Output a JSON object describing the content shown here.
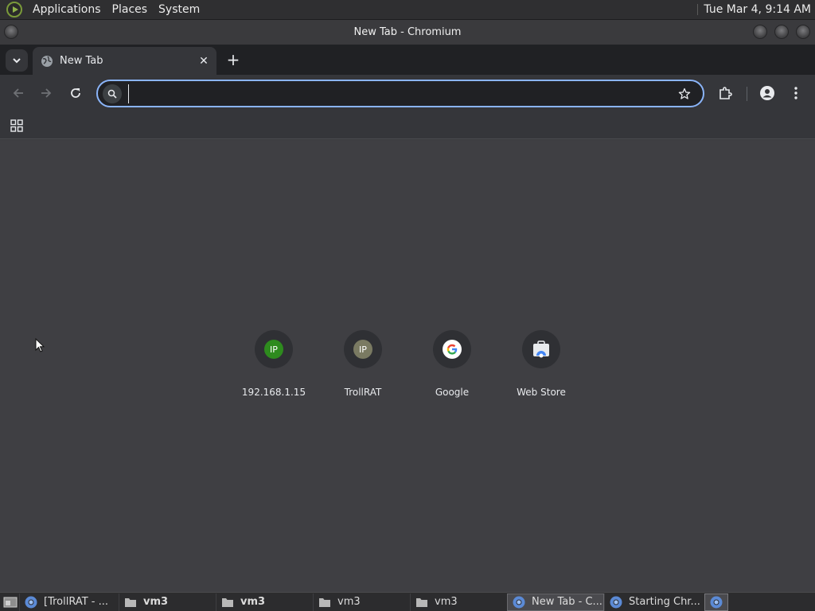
{
  "system_panel": {
    "menus": [
      "Applications",
      "Places",
      "System"
    ],
    "clock": "Tue Mar  4,  9:14 AM"
  },
  "window": {
    "title": "New Tab - Chromium"
  },
  "tabs": [
    {
      "title": "New Tab",
      "icon": "globe-icon",
      "close": "✕"
    }
  ],
  "toolbar": {
    "new_tab_glyph": "+",
    "omnibox_value": "",
    "omnibox_placeholder": ""
  },
  "shortcuts": [
    {
      "label": "192.168.1.15",
      "icon_text": "IP",
      "icon_color": "#2e8b1e"
    },
    {
      "label": "TrollRAT",
      "icon_text": "IP",
      "icon_color": "#7a7a62"
    },
    {
      "label": "Google",
      "icon": "google-icon"
    },
    {
      "label": "Web Store",
      "icon": "web-store-icon"
    }
  ],
  "taskbar": {
    "tasks": [
      {
        "label": "[TrollRAT - ...",
        "icon": "chromium-icon",
        "bold": false
      },
      {
        "label": "vm3",
        "icon": "folder-icon",
        "bold": true
      },
      {
        "label": "vm3",
        "icon": "folder-icon",
        "bold": true
      },
      {
        "label": "vm3",
        "icon": "folder-icon",
        "bold": false
      },
      {
        "label": "vm3",
        "icon": "folder-icon",
        "bold": false
      },
      {
        "label": "New Tab - C...",
        "icon": "chromium-icon",
        "bold": false,
        "active": true
      },
      {
        "label": "Starting Chr...",
        "icon": "chromium-icon",
        "bold": false
      }
    ]
  },
  "colors": {
    "accent": "#8ab4f8",
    "content_bg": "#3f3f43",
    "toolbar_bg": "#35363a",
    "tabstrip_bg": "#202124"
  }
}
